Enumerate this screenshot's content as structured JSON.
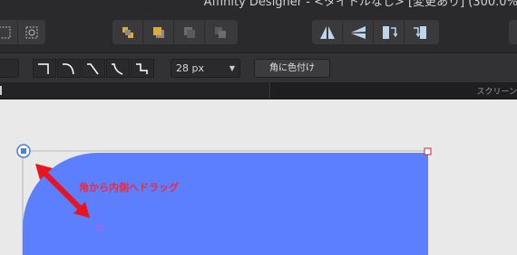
{
  "window": {
    "title": "Affinity Designer - <タイトルなし> [変更あり] (300.0%)"
  },
  "toolbar": {
    "arrange_group": [
      "arrange-forward-icon",
      "arrange-front-icon",
      "arrange-back-icon",
      "arrange-backward-icon"
    ],
    "flip_group": [
      "flip-horizontal-icon",
      "flip-vertical-icon",
      "rotate-left-icon",
      "rotate-right-icon"
    ]
  },
  "context_toolbar": {
    "corner_types": [
      "round-corner",
      "concave-corner",
      "chamfer-corner",
      "straight-corner",
      "step-corner"
    ],
    "radius_value": "28 px",
    "color_corner_label": "角に色付け"
  },
  "tabbar": {
    "screen_label": "スクリーン"
  },
  "canvas": {
    "shape_fill": "#5b7fff",
    "annotation": "角から内側へドラッグ",
    "annotation_color": "#ee2a3b"
  }
}
